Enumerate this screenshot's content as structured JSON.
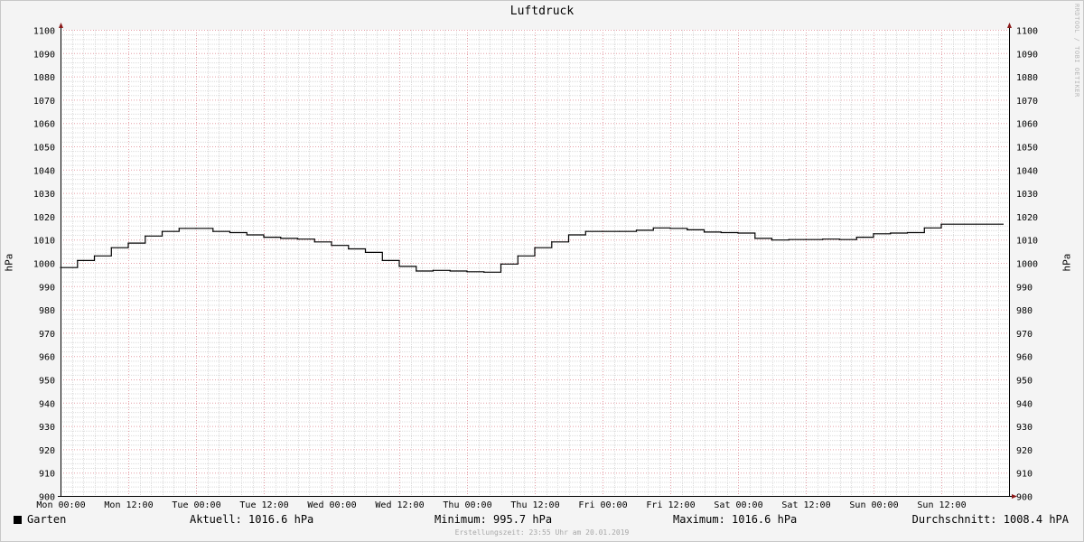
{
  "chart_data": {
    "type": "line",
    "title": "Luftdruck",
    "ylabel": "hPa",
    "ylim": [
      900,
      1100
    ],
    "y_ticks": [
      900,
      910,
      920,
      930,
      940,
      950,
      960,
      970,
      980,
      990,
      1000,
      1010,
      1020,
      1030,
      1040,
      1050,
      1060,
      1070,
      1080,
      1090,
      1100
    ],
    "x_ticks": [
      "Mon 00:00",
      "Mon 12:00",
      "Tue 00:00",
      "Tue 12:00",
      "Wed 00:00",
      "Wed 12:00",
      "Thu 00:00",
      "Thu 12:00",
      "Fri 00:00",
      "Fri 12:00",
      "Sat 00:00",
      "Sat 12:00",
      "Sun 00:00",
      "Sun 12:00"
    ],
    "xlim_hours": [
      0,
      168
    ],
    "grid": true,
    "series": [
      {
        "name": "Garten",
        "color": "#000000",
        "x_hours": [
          0,
          3,
          6,
          9,
          12,
          15,
          18,
          21,
          24,
          27,
          30,
          33,
          36,
          39,
          42,
          45,
          48,
          51,
          54,
          57,
          60,
          63,
          66,
          69,
          72,
          75,
          78,
          81,
          84,
          87,
          90,
          93,
          96,
          99,
          102,
          105,
          108,
          111,
          114,
          117,
          120,
          123,
          126,
          129,
          132,
          135,
          138,
          141,
          144,
          147,
          150,
          153,
          156,
          159,
          162,
          165,
          168
        ],
        "values": [
          998.0,
          1001.0,
          1003.0,
          1006.5,
          1008.5,
          1011.5,
          1013.5,
          1014.8,
          1014.8,
          1013.5,
          1013.0,
          1012.0,
          1011.0,
          1010.5,
          1010.2,
          1009.0,
          1007.5,
          1006.0,
          1004.5,
          1001.0,
          998.5,
          996.5,
          996.8,
          996.5,
          996.2,
          996.0,
          999.5,
          1003.0,
          1006.5,
          1009.0,
          1012.0,
          1013.5,
          1013.5,
          1013.5,
          1014.0,
          1015.0,
          1014.8,
          1014.2,
          1013.2,
          1013.0,
          1012.8,
          1010.5,
          1009.8,
          1010.0,
          1010.0,
          1010.2,
          1010.0,
          1011.0,
          1012.5,
          1012.8,
          1013.0,
          1015.0,
          1016.6
        ]
      }
    ]
  },
  "legend": {
    "series_name": "Garten",
    "current": "Aktuell: 1016.6 hPa",
    "minimum": "Minimum: 995.7 hPa",
    "maximum": "Maximum: 1016.6 hPa",
    "average": "Durchschnitt: 1008.4 hPA"
  },
  "created": "Erstellungszeit: 23:55 Uhr am 20.01.2019",
  "watermark": "RRDTOOL / TOBI OETIKER"
}
